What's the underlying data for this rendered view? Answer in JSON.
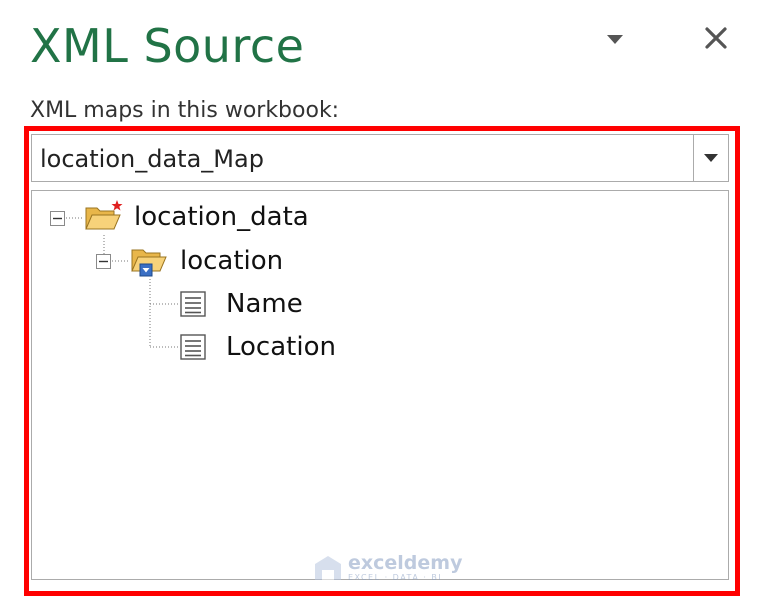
{
  "pane": {
    "title": "XML Source",
    "menu_icon": "chevron-down-icon",
    "close_icon": "close-icon"
  },
  "maps": {
    "label": "XML maps in this workbook:",
    "selected": "location_data_Map"
  },
  "tree": {
    "root": {
      "label": "location_data",
      "icon": "root-folder-icon",
      "expanded": true
    },
    "element": {
      "label": "location",
      "icon": "repeating-folder-icon",
      "expanded": true
    },
    "fields": [
      {
        "label": "Name",
        "icon": "field-icon"
      },
      {
        "label": "Location",
        "icon": "field-icon"
      }
    ]
  },
  "watermark": {
    "name": "exceldemy",
    "tagline": "EXCEL · DATA · BI"
  },
  "colors": {
    "title": "#217346",
    "highlight": "#ff0000",
    "border": "#ababab"
  }
}
